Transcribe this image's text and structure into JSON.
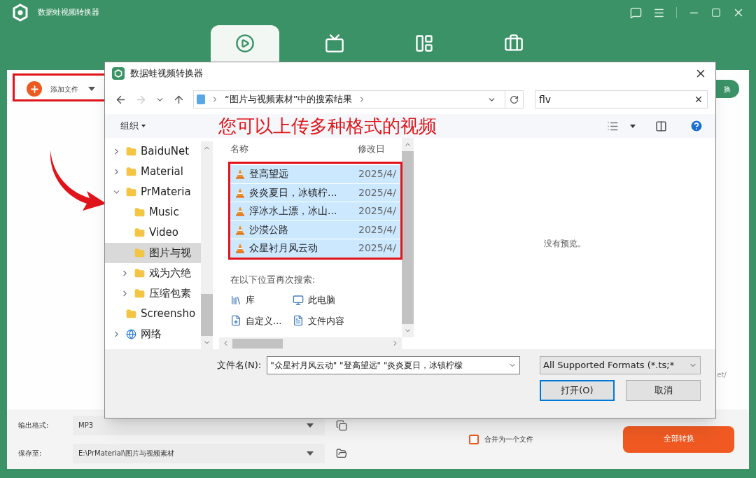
{
  "app": {
    "title": "数据蛙视频转换器",
    "tabs": [
      {
        "kind": "convert",
        "selected": true
      },
      {
        "kind": "tv",
        "selected": false
      },
      {
        "kind": "layout",
        "selected": false
      },
      {
        "kind": "toolbox",
        "selected": false
      }
    ],
    "add_file": "添加文件",
    "right_button": "换",
    "cut_text": "et/",
    "output_format": {
      "label": "输出格式:",
      "value": "MP3"
    },
    "save_to": {
      "label": "保存至:",
      "value": "E:\\PrMaterial\\图片与视频素材"
    },
    "merge": {
      "label": "合并为一个文件",
      "checked": false
    },
    "convert_all": "全部转换"
  },
  "dialog": {
    "title": "数据蛙视频转换器",
    "breadcrumb": "“图片与视频素材”中的搜索结果",
    "search": "flv",
    "organize": "组织",
    "annotation": "您可以上传多种格式的视频",
    "tree": [
      {
        "label": "BaiduNet",
        "kind": "folder",
        "expanded": false,
        "selected": false
      },
      {
        "label": "Material",
        "kind": "folder",
        "expanded": false,
        "selected": false
      },
      {
        "label": "PrMateria",
        "kind": "folder",
        "expanded": true,
        "selected": false,
        "children": [
          {
            "label": "Music",
            "kind": "folder",
            "selected": false
          },
          {
            "label": "Video",
            "kind": "folder",
            "selected": false
          },
          {
            "label": "图片与视",
            "kind": "folder",
            "selected": true
          },
          {
            "label": "戏为六绝",
            "kind": "folder",
            "expanded": false,
            "selected": false
          },
          {
            "label": "压缩包素",
            "kind": "folder",
            "expanded": false,
            "selected": false
          }
        ]
      },
      {
        "label": "Screensho",
        "kind": "folder",
        "selected": false
      },
      {
        "label": "网络",
        "kind": "network",
        "expanded": false,
        "selected": false
      }
    ],
    "columns": [
      "名称",
      "修改日"
    ],
    "files": [
      {
        "name": "登高望远",
        "date": "2025/4/",
        "selected": true
      },
      {
        "name": "炎炎夏日，冰镇柠...",
        "date": "2025/4/",
        "selected": true
      },
      {
        "name": "浮冰水上漂，冰山...",
        "date": "2025/4/",
        "selected": true
      },
      {
        "name": "沙漠公路",
        "date": "2025/4/",
        "selected": true
      },
      {
        "name": "众星衬月风云动",
        "date": "2025/4/",
        "selected": true
      }
    ],
    "search_again": {
      "label": "在以下位置再次搜索:",
      "items": [
        {
          "kind": "library",
          "label": "库"
        },
        {
          "kind": "computer",
          "label": "此电脑"
        },
        {
          "kind": "custom",
          "label": "自定义..."
        },
        {
          "kind": "file",
          "label": "文件内容"
        }
      ]
    },
    "preview": "没有预览。",
    "filename": {
      "label": "文件名(N):",
      "value": "\"众星衬月风云动\" \"登高望远\" \"炎炎夏日，冰镇柠檬"
    },
    "filter": "All Supported Formats (*.ts;*",
    "buttons": [
      "打开(O)",
      "取消"
    ]
  }
}
